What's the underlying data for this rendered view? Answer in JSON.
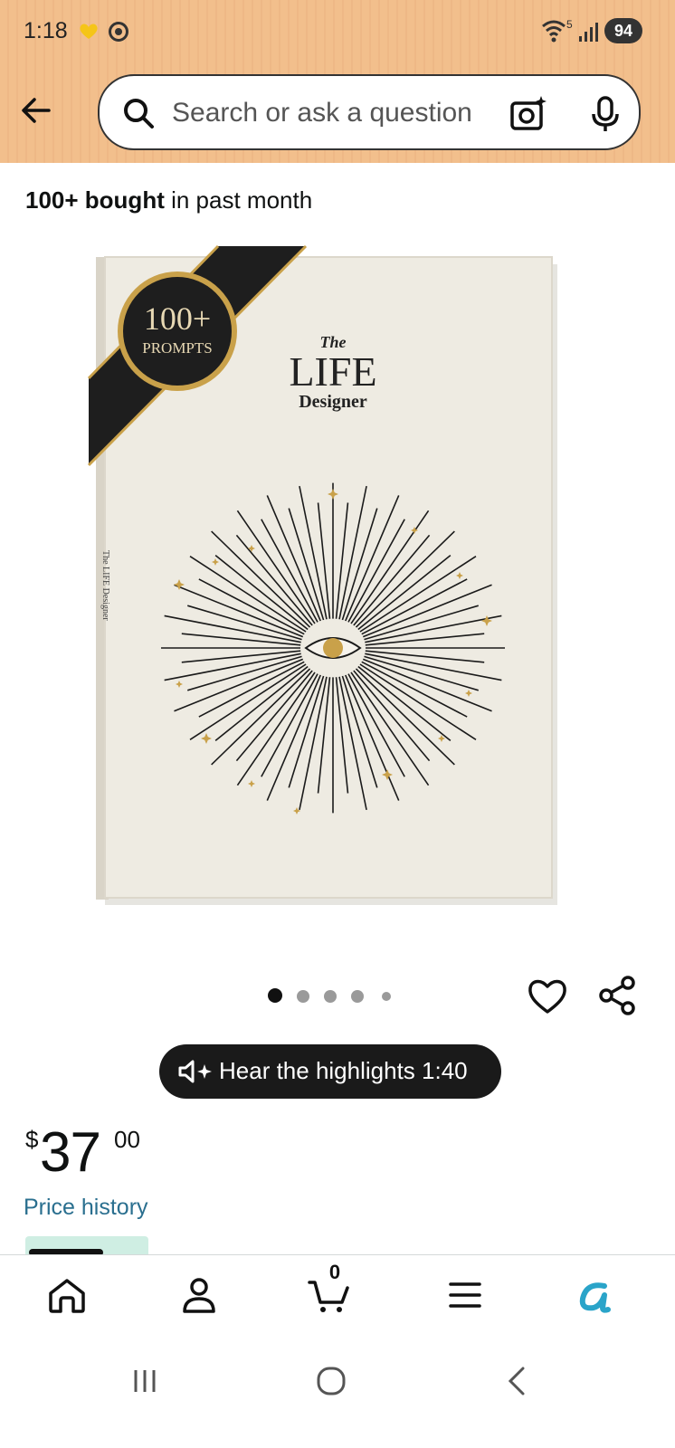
{
  "status_bar": {
    "time": "1:18",
    "wifi_label": "5",
    "battery": "94"
  },
  "header": {
    "search_placeholder": "Search or ask a question"
  },
  "product": {
    "bought_count": "100+ bought",
    "bought_suffix": " in past month",
    "image": {
      "badge_number": "100+",
      "badge_label": "PROMPTS",
      "cover_the": "The",
      "cover_title": "LIFE",
      "cover_subtitle": "Designer",
      "spine_text": "The LIFE Designer"
    },
    "carousel": {
      "total": 5,
      "active_index": 0
    },
    "audio_label": "Hear the highlights 1:40",
    "price": {
      "symbol": "$",
      "whole": "37",
      "fraction": "00"
    },
    "price_history": "Price history"
  },
  "bottom_nav": {
    "items": [
      "home",
      "account",
      "cart",
      "menu",
      "rufus"
    ],
    "cart_count": "0"
  },
  "colors": {
    "header_bg": "#f2bf8c",
    "link": "#2a6f8f",
    "rufus_accent": "#2aa4c9",
    "gold": "#c9a14a"
  }
}
